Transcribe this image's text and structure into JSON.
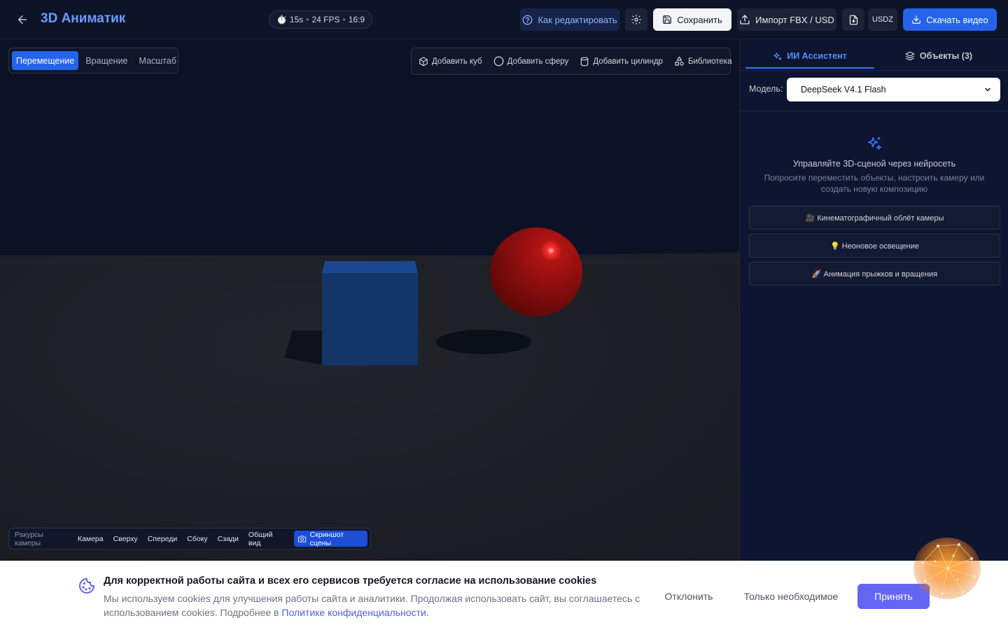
{
  "header": {
    "title": "3D Аниматик",
    "meta": {
      "duration": "15s",
      "fps": "24 FPS",
      "aspect": "16:9",
      "separator": "•"
    },
    "buttons": {
      "help": "Как редактировать",
      "save": "Сохранить",
      "import": "Импорт FBX / USD",
      "usdz": "USDZ",
      "download": "Скачать видео"
    }
  },
  "viewport": {
    "modes": [
      "Перемещение",
      "Вращение",
      "Масштаб"
    ],
    "active_mode": "Перемещение",
    "add": {
      "cube": "Добавить куб",
      "sphere": "Добавить сферу",
      "cylinder": "Добавить цилиндр",
      "library": "Библиотека"
    },
    "camera": {
      "label": "Ракурсы камеры",
      "views": [
        "Камера",
        "Сверху",
        "Спереди",
        "Сбоку",
        "Сзади",
        "Общий вид"
      ],
      "screenshot": "Скриншот сцены"
    }
  },
  "panel": {
    "tabs": {
      "assistant": "ИИ Ассистент",
      "objects": "Объекты (3)"
    },
    "active_tab": "assistant",
    "model_label": "Модель:",
    "model_value": "DeepSeek V4.1 Flash",
    "intro_title": "Управляйте 3D-сценой через нейросеть",
    "intro_subtitle": "Попросите переместить объекты, настроить камеру или создать новую композицию",
    "suggestions": [
      "🎥 Кинематографичный облёт камеры",
      "💡 Неоновое освещение",
      "🚀 Анимация прыжков и вращения"
    ]
  },
  "cookie": {
    "title": "Для корректной работы сайта и всех его сервисов требуется согласие на использование cookies",
    "text": "Мы используем cookies для улучшения работы сайта и аналитики. Продолжая использовать сайт, вы соглашаетесь с использованием cookies. Подробнее в",
    "link": "Политике конфиденциальности",
    "suffix": ".",
    "decline": "Отклонить",
    "necessary": "Только необходимое",
    "accept": "Принять"
  },
  "colors": {
    "accent": "#2563eb",
    "title": "#6b9bff",
    "cube": "#133568",
    "sphere": "#8d0e0e",
    "accept": "#6366f1"
  }
}
